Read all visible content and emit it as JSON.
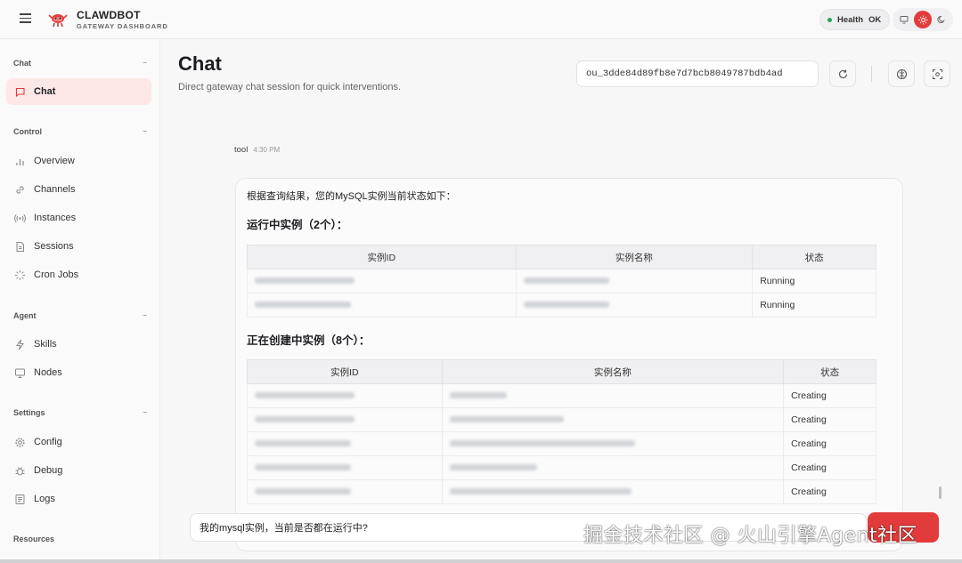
{
  "header": {
    "brand_title": "CLAWDBOT",
    "brand_subtitle": "GATEWAY DASHBOARD",
    "health_label": "Health",
    "health_status": "OK",
    "status_color": "#22a559",
    "accent_color": "#e23b3b"
  },
  "sidebar": {
    "sections": [
      {
        "label": "Chat",
        "items": [
          {
            "label": "Chat",
            "icon": "chat-icon",
            "active": true
          }
        ]
      },
      {
        "label": "Control",
        "items": [
          {
            "label": "Overview",
            "icon": "bar-chart-icon"
          },
          {
            "label": "Channels",
            "icon": "link-icon"
          },
          {
            "label": "Instances",
            "icon": "broadcast-icon"
          },
          {
            "label": "Sessions",
            "icon": "document-icon"
          },
          {
            "label": "Cron Jobs",
            "icon": "loader-icon"
          }
        ]
      },
      {
        "label": "Agent",
        "items": [
          {
            "label": "Skills",
            "icon": "bolt-icon"
          },
          {
            "label": "Nodes",
            "icon": "monitor-icon"
          }
        ]
      },
      {
        "label": "Settings",
        "items": [
          {
            "label": "Config",
            "icon": "gear-icon"
          },
          {
            "label": "Debug",
            "icon": "bug-icon"
          },
          {
            "label": "Logs",
            "icon": "log-icon"
          }
        ]
      },
      {
        "label": "Resources",
        "items": []
      }
    ]
  },
  "main": {
    "title": "Chat",
    "subtitle": "Direct gateway chat session for quick interventions.",
    "session_key": "ou_3dde84d89fb8e7d7bcb8049787bdb4ad"
  },
  "message": {
    "role": "tool",
    "time": "4:30 PM",
    "intro": "根据查询结果，您的MySQL实例当前状态如下：",
    "running_heading": "运行中实例（2个）：",
    "creating_heading": "正在创建中实例（8个）：",
    "columns": [
      "实例ID",
      "实例名称",
      "状态"
    ],
    "running_rows": [
      {
        "status": "Running"
      },
      {
        "status": "Running"
      }
    ],
    "creating_rows": [
      {
        "status": "Creating"
      },
      {
        "status": "Creating"
      },
      {
        "status": "Creating"
      },
      {
        "status": "Creating"
      },
      {
        "status": "Creating"
      }
    ]
  },
  "composer": {
    "value": "我的mysql实例，当前是否都在运行中?"
  },
  "watermark": "掘金技术社区 @ 火山引擎Agent社区"
}
